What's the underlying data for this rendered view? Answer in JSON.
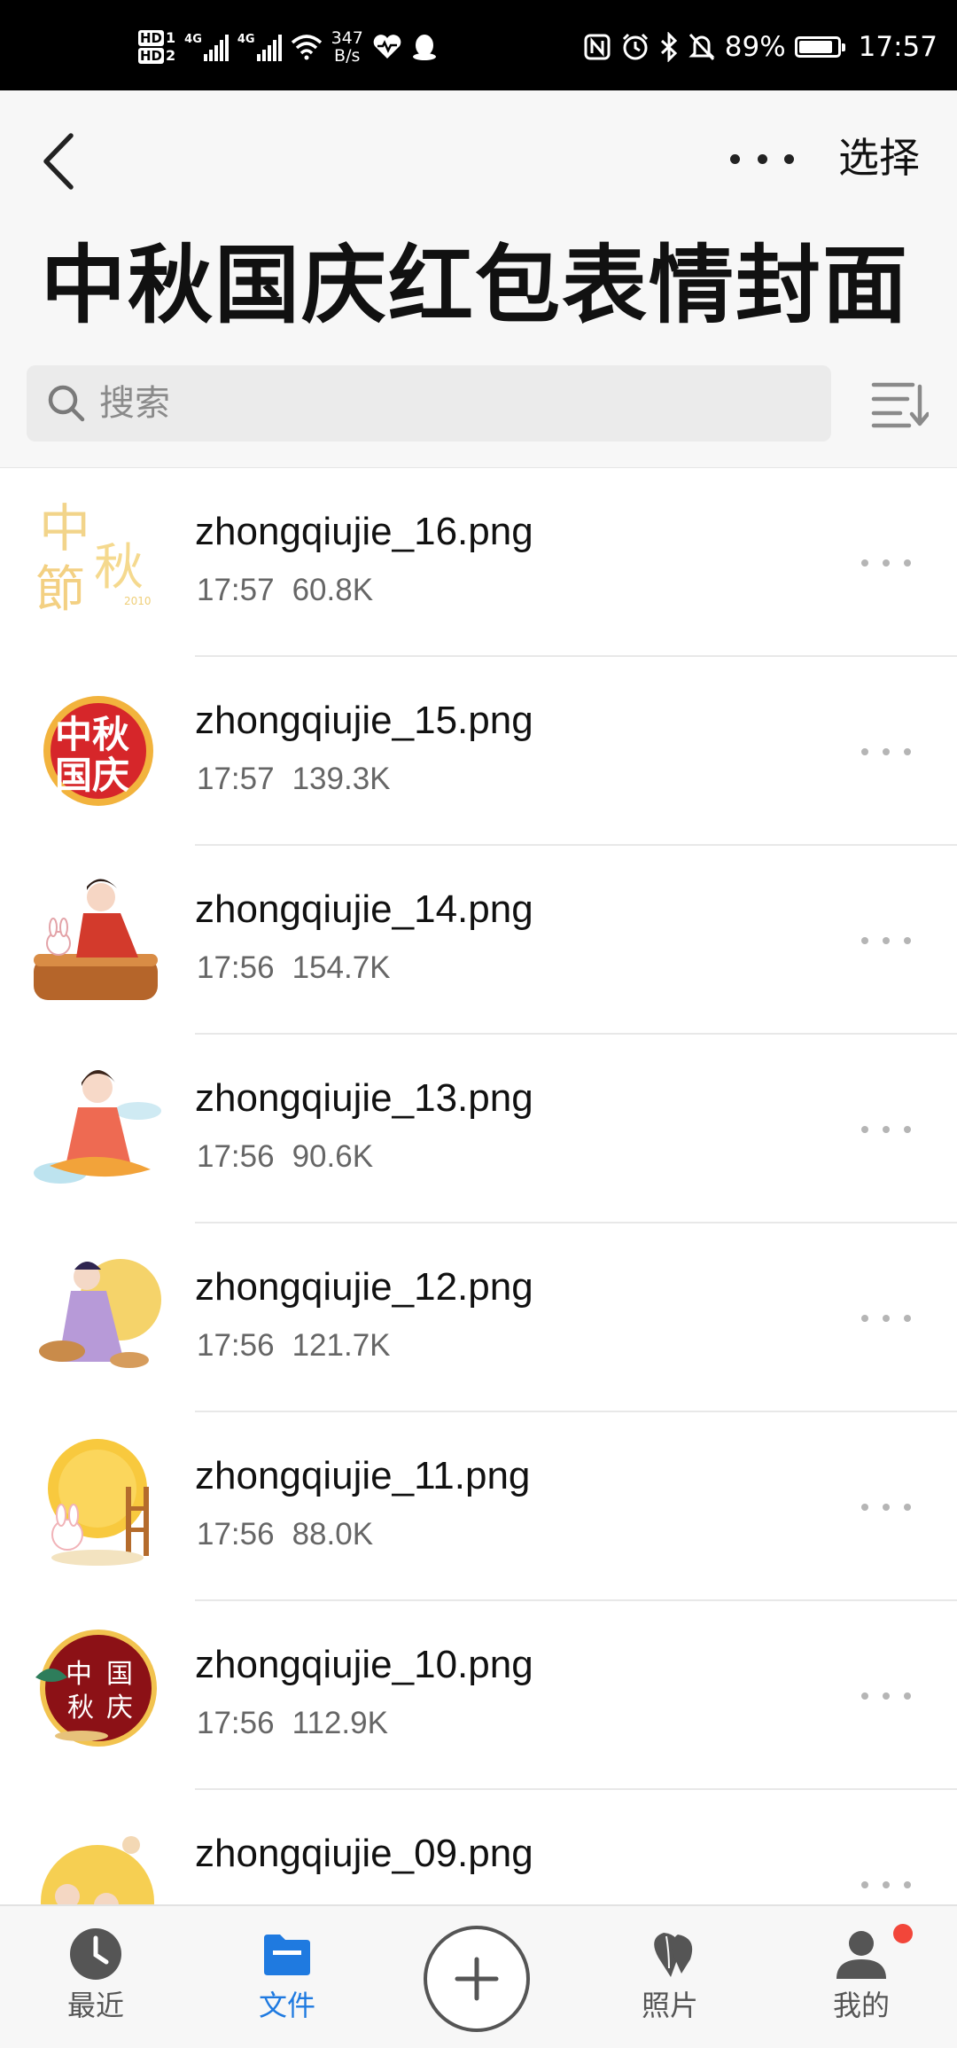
{
  "status_bar": {
    "hd1": "HD",
    "hd1_sub": "1",
    "hd2": "HD",
    "hd2_sub": "2",
    "gen1": "4G",
    "gen2": "4G",
    "net_speed_value": "347",
    "net_speed_unit": "B/s",
    "battery_percent": "89%",
    "battery_level": 0.89,
    "time": "17:57"
  },
  "header": {
    "title": "中秋国庆红包表情封面",
    "select_label": "选择"
  },
  "search": {
    "placeholder": "搜索"
  },
  "files": [
    {
      "name": "zhongqiujie_16.png",
      "time": "17:57",
      "size": "60.8K",
      "thumb": "mid-autumn-gold-calligraphy"
    },
    {
      "name": "zhongqiujie_15.png",
      "time": "17:57",
      "size": "139.3K",
      "thumb": "mid-autumn-red-badge"
    },
    {
      "name": "zhongqiujie_14.png",
      "time": "17:56",
      "size": "154.7K",
      "thumb": "girl-on-mooncake"
    },
    {
      "name": "zhongqiujie_13.png",
      "time": "17:56",
      "size": "90.6K",
      "thumb": "girl-on-cloud"
    },
    {
      "name": "zhongqiujie_12.png",
      "time": "17:56",
      "size": "121.7K",
      "thumb": "fairy-with-moon"
    },
    {
      "name": "zhongqiujie_11.png",
      "time": "17:56",
      "size": "88.0K",
      "thumb": "rabbit-mooncake"
    },
    {
      "name": "zhongqiujie_10.png",
      "time": "17:56",
      "size": "112.9K",
      "thumb": "red-moon-badge"
    },
    {
      "name": "zhongqiujie_09.png",
      "time": "",
      "size": "",
      "thumb": "family-moon"
    }
  ],
  "bottom_nav": {
    "recent": "最近",
    "files": "文件",
    "photos": "照片",
    "mine": "我的",
    "active": "files"
  },
  "colors": {
    "accent": "#1f7ae0",
    "notification": "#f2463a"
  }
}
